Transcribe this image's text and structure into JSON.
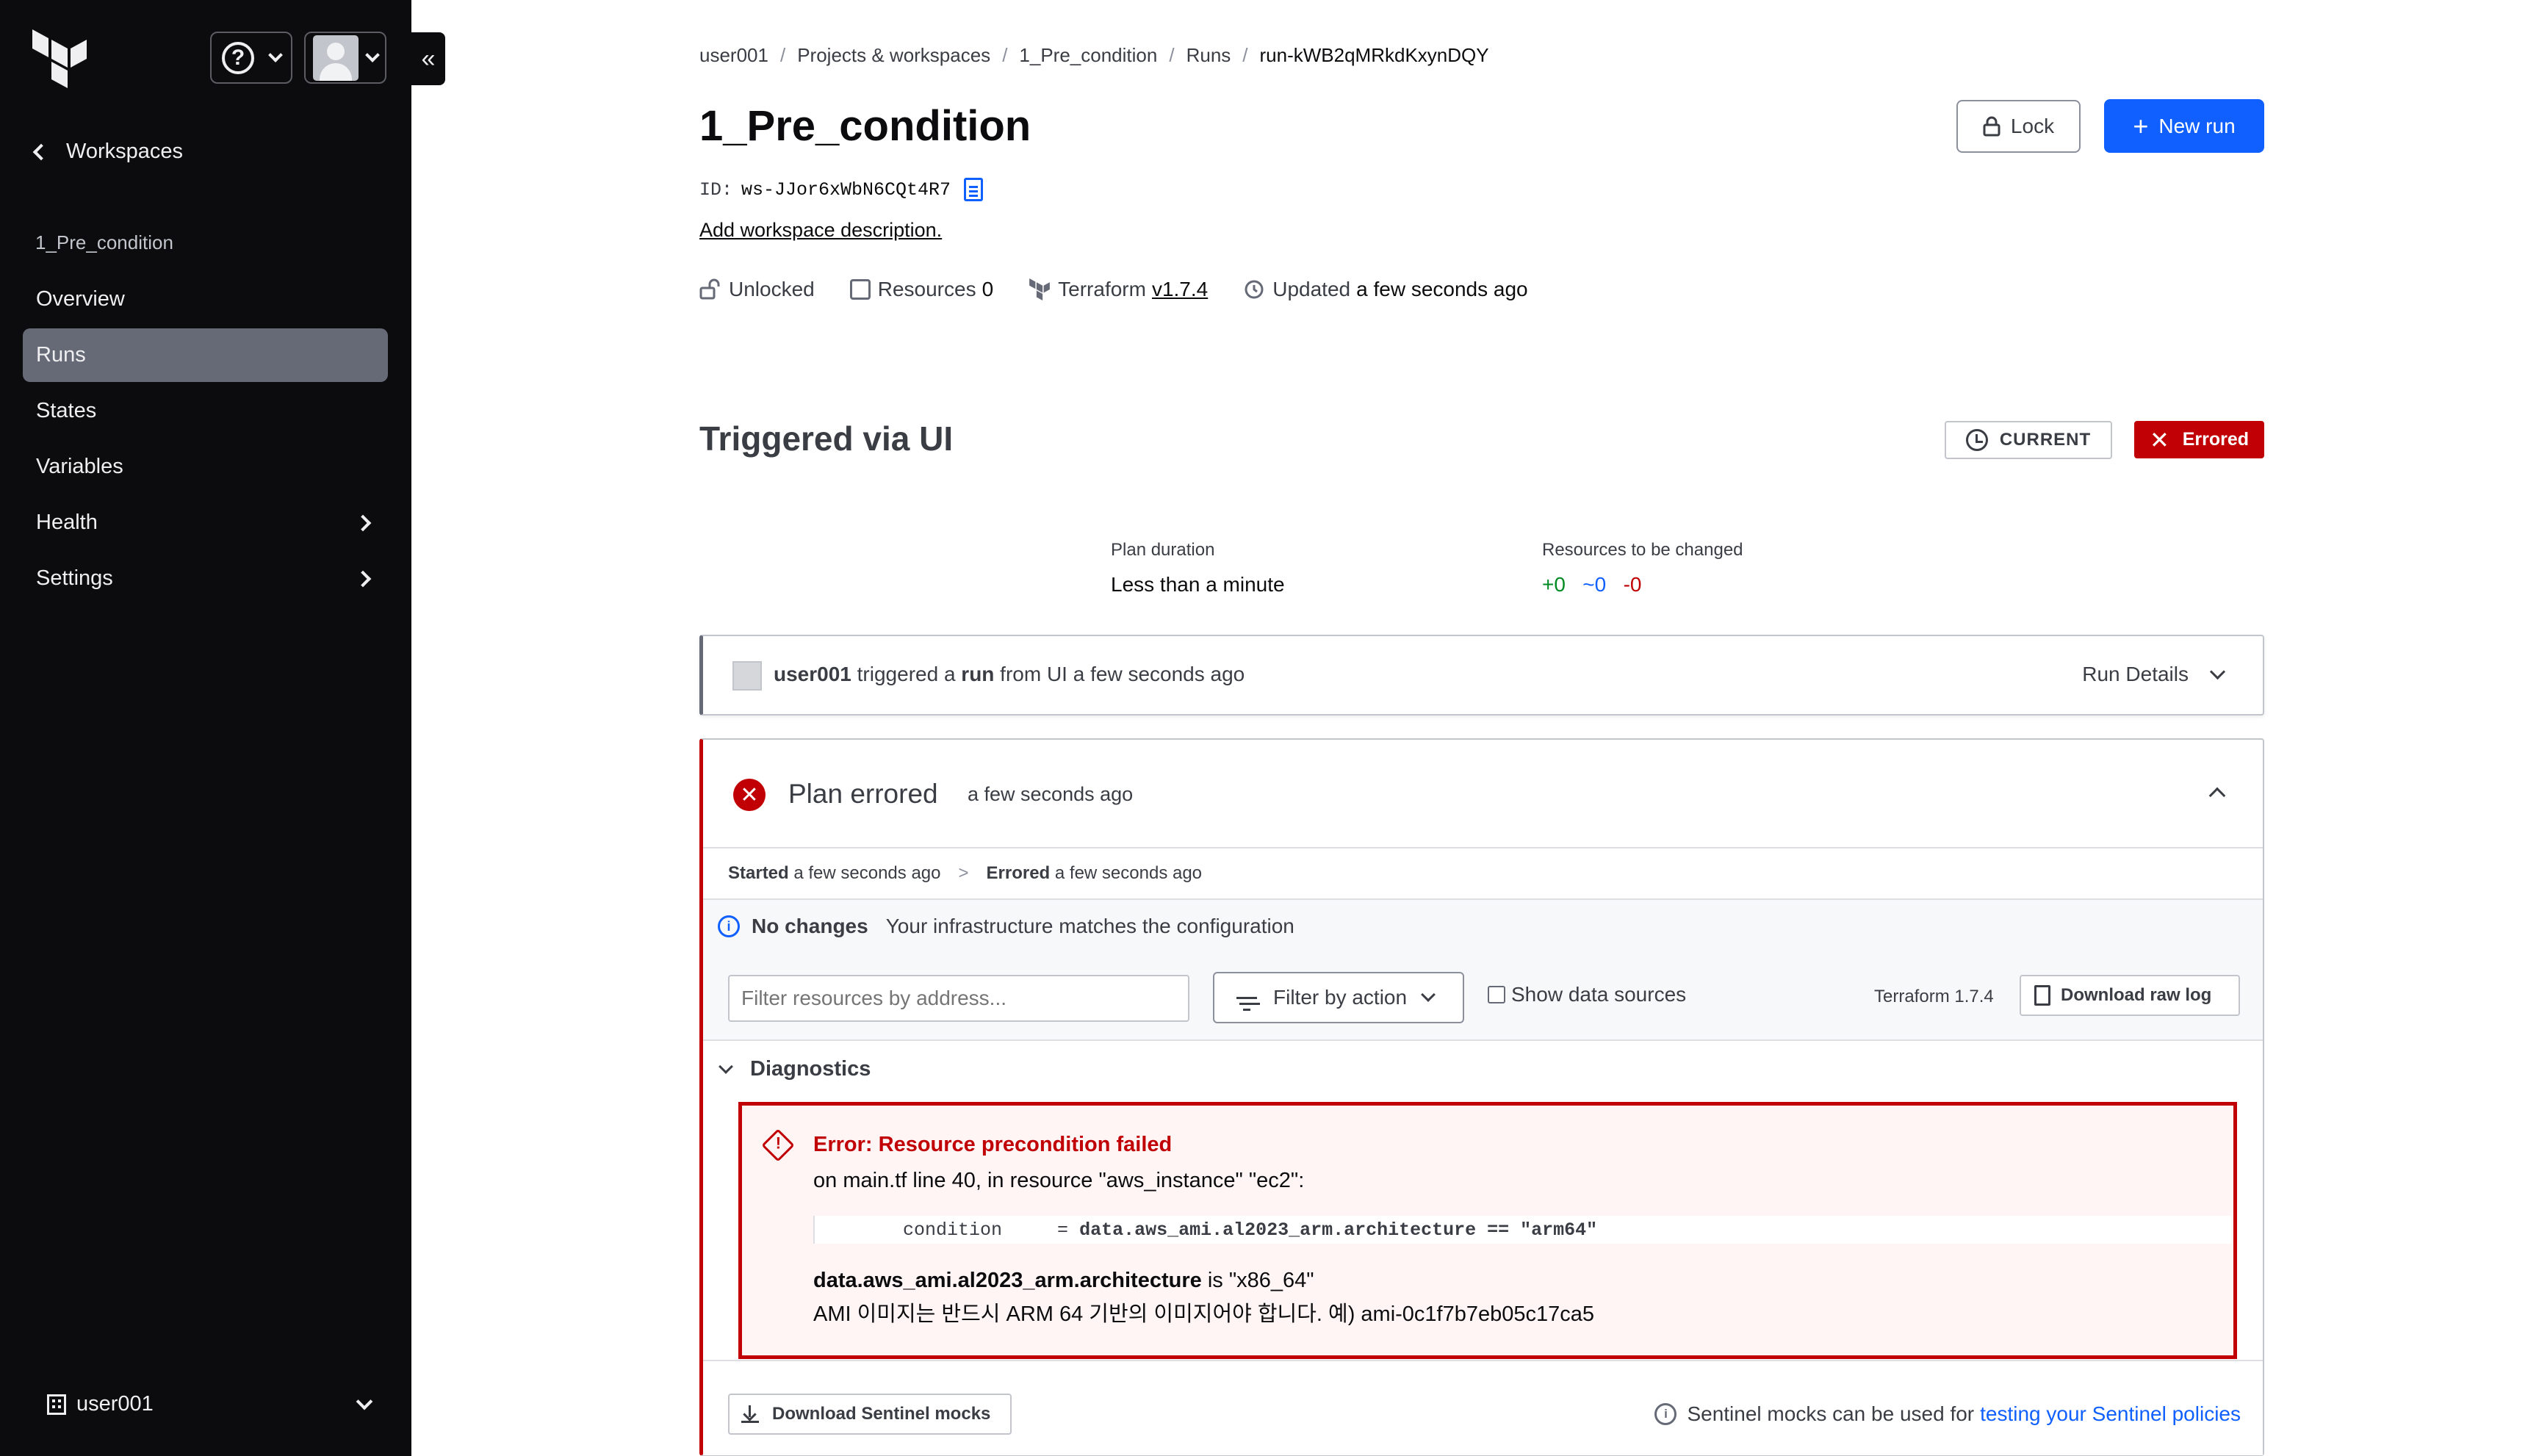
{
  "sidebar": {
    "back_label": "Workspaces",
    "workspace_name": "1_Pre_condition",
    "items": [
      {
        "label": "Overview"
      },
      {
        "label": "Runs"
      },
      {
        "label": "States"
      },
      {
        "label": "Variables"
      },
      {
        "label": "Health"
      },
      {
        "label": "Settings"
      }
    ],
    "active_item": "Runs",
    "org_name": "user001",
    "collapse_glyph": "«",
    "help_glyph": "?"
  },
  "breadcrumb": [
    "user001",
    "Projects & workspaces",
    "1_Pre_condition",
    "Runs",
    "run-kWB2qMRkdKxynDQY"
  ],
  "workspace": {
    "title": "1_Pre_condition",
    "id_label": "ID:",
    "id_value": "ws-JJor6xWbN6CQt4R7",
    "add_description": "Add workspace description.",
    "lock_label": "Lock",
    "new_run_label": "New run",
    "new_run_glyph": "+",
    "meta": {
      "lock_state": "Unlocked",
      "resources_label": "Resources",
      "resources_count": "0",
      "terraform_label": "Terraform",
      "terraform_version": "v1.7.4",
      "updated_label": "Updated",
      "updated_value": "a few seconds ago"
    }
  },
  "run": {
    "title": "Triggered via UI",
    "current_badge": "CURRENT",
    "status_badge": "Errored",
    "plan_duration_label": "Plan duration",
    "plan_duration_value": "Less than a minute",
    "resources_changed_label": "Resources to be changed",
    "add": "+0",
    "change": "~0",
    "destroy": "-0",
    "trigger": {
      "user": "user001",
      "t1": " triggered a ",
      "run_word": "run",
      "t2": " from UI a few seconds ago"
    },
    "run_details_label": "Run Details"
  },
  "plan": {
    "title": "Plan errored",
    "time": "a few seconds ago",
    "error_glyph": "✕",
    "started_label": "Started",
    "started_value": "a few seconds ago",
    "timeline_sep": ">",
    "errored_label": "Errored",
    "errored_value": "a few seconds ago",
    "info_glyph": "i",
    "no_changes_label": "No changes",
    "no_changes_text": "Your infrastructure matches the configuration",
    "filter_placeholder": "Filter resources by address...",
    "filter_action_label": "Filter by action",
    "show_data_sources_label": "Show data sources",
    "terraform_version": "Terraform 1.7.4",
    "download_raw_log": "Download raw log",
    "diagnostics_label": "Diagnostics",
    "error": {
      "title": "Error: Resource precondition failed",
      "location": "on main.tf line 40, in resource \"aws_instance\" \"ec2\":",
      "code_key": "        condition     = ",
      "code_value": "data.aws_ami.al2023_arm.architecture == \"arm64\"",
      "expr_name": "data.aws_ami.al2023_arm.architecture",
      "expr_value": " is \"x86_64\"",
      "message": "AMI 이미지는 반드시 ARM 64 기반의 이미지어야 합니다. 예) ami-0c1f7b7eb05c17ca5"
    },
    "download_sentinel": "Download Sentinel mocks",
    "sentinel_note": "Sentinel mocks can be used for",
    "sentinel_link": "testing your Sentinel policies"
  },
  "colors": {
    "sidebar_bg": "#0c0c0e",
    "accent": "#1060ff",
    "error": "#c00005",
    "success": "#008a22"
  }
}
